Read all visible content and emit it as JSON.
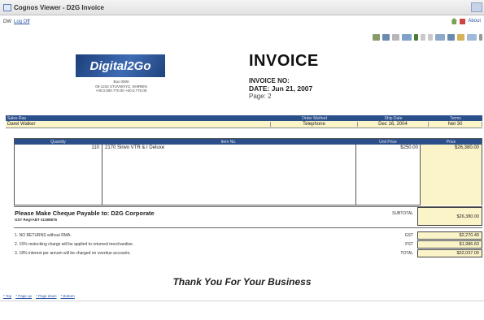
{
  "window": {
    "title": "Cognos Viewer - D2G Invoice"
  },
  "menubar": {
    "user_label": "DW",
    "logoff": "Log Off",
    "about": "About"
  },
  "company": {
    "logo_text": "Digital2Go",
    "address_lines": [
      "Box 0000",
      "00-1234 STUVWXYZ, SHIRBIN",
      "+00.0.000.770.00 +00.0.770.00"
    ]
  },
  "invoice": {
    "title": "INVOICE",
    "number_label": "INVOICE NO:",
    "date_label": "DATE: Jun 21, 2007",
    "page_label": "Page: 2"
  },
  "order_info": {
    "headers": [
      "Sales Rep",
      "Order Method",
      "Ship Date",
      "Terms"
    ],
    "values": [
      "Darel Walker",
      "Telephone",
      "Dec 16, 2004",
      "Net 30"
    ]
  },
  "items": {
    "headers": [
      "Quantity",
      "Item No.",
      "Unit Price",
      "Price"
    ],
    "rows": [
      {
        "qty": "110",
        "item": "2170 Sirwo VTR & I Deluxe",
        "unit": "$250.00",
        "price": "$26,380.00"
      }
    ]
  },
  "summary": {
    "cheque_text": "Please Make Cheque Payable to: D2G Corporate",
    "gst_reg": "GST Reg#ABT 01389876",
    "subtotal_label": "SUBTOTAL",
    "subtotal": "$26,380.00",
    "gst_label": "GST",
    "gst": "$2,270.40",
    "pst_label": "PST",
    "pst": "$1,986.60",
    "total_label": "TOTAL",
    "total": "$32,037.00"
  },
  "terms": [
    "1. NO RETURNS without RMA.",
    "2. 15% restocking charge will be applied to returned merchandise.",
    "3. 18% interest per annum will be charged on overdue accounts."
  ],
  "thanks": "Thank You For Your Business",
  "footer_links": [
    "* Top",
    "* Page up",
    "* Page down",
    "* Bottom"
  ],
  "colors": {
    "header_blue": "#2b4f8a",
    "cream": "#fbf4c8"
  }
}
